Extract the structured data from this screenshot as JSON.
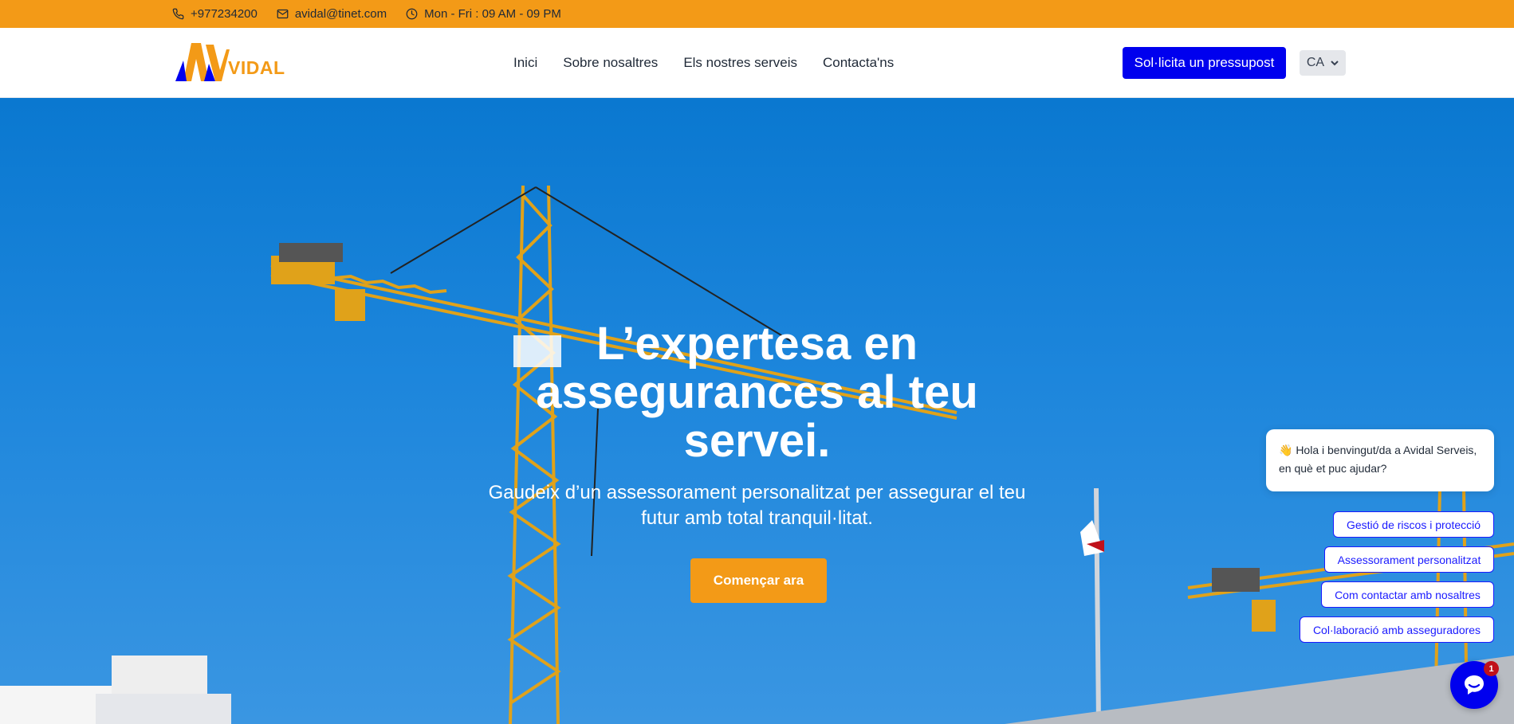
{
  "topbar": {
    "phone": "+977234200",
    "email": "avidal@tinet.com",
    "hours": "Mon - Fri : 09 AM - 09 PM"
  },
  "header": {
    "logo_text": "VIDAL",
    "nav": [
      "Inici",
      "Sobre nosaltres",
      "Els nostres serveis",
      "Contacta'ns"
    ],
    "cta_label": "Sol·licita un pressupost",
    "language": "CA"
  },
  "hero": {
    "title_lines": [
      "L’expertesa en",
      "assegurances al teu",
      "servei."
    ],
    "subtitle_lines": [
      "Gaudeix d’un assessorament personalitzat per assegurar el teu",
      "futur amb total tranquil·litat."
    ],
    "button_label": "Començar ara"
  },
  "chat": {
    "greeting_line1": "👋 Hola i benvingut/da a Avidal Serveis,",
    "greeting_line2": "en què et puc ajudar?",
    "options": [
      "Gestió de riscos i protecció",
      "Assessorament personalitzat",
      "Com contactar amb nosaltres",
      "Col·laboració amb asseguradores"
    ],
    "badge_count": "1"
  },
  "colors": {
    "accent_orange": "#f39a17",
    "brand_blue": "#0000ee",
    "sky_blue": "#1d86dc"
  }
}
